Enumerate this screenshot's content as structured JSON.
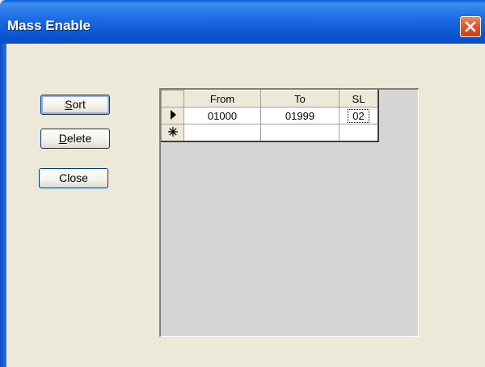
{
  "window": {
    "title": "Mass Enable",
    "close_icon": "close-icon"
  },
  "buttons": {
    "sort": {
      "mnemonic": "S",
      "rest": "ort"
    },
    "delete": {
      "mnemonic": "D",
      "rest": "elete"
    },
    "close": {
      "label": "Close"
    }
  },
  "grid": {
    "columns": [
      "From",
      "To",
      "SL"
    ],
    "rows": [
      {
        "indicator": "current-row-arrow-icon",
        "from": "01000",
        "to": "01999",
        "sl": "02"
      },
      {
        "indicator": "new-row-asterisk-icon",
        "from": "",
        "to": "",
        "sl": ""
      }
    ]
  },
  "colors": {
    "titlebar": "#1f6ee6",
    "dialog_background": "#ece9d8",
    "grid_background": "#d6d6d6",
    "close_button": "#e0532c"
  }
}
